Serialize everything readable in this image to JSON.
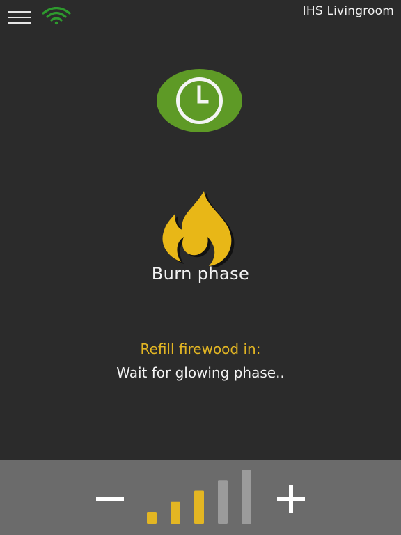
{
  "header": {
    "device_name": "IHS Livingroom",
    "menu_icon": "hamburger-menu-icon",
    "wifi_icon": "wifi-signal-icon",
    "wifi_color": "#2e9a2e"
  },
  "main": {
    "timer_icon": "clock-icon",
    "timer_color": "#5e9a26",
    "phase_icon": "flame-icon",
    "phase_color": "#e8b717",
    "phase_label": "Burn phase",
    "refill_label": "Refill firewood in:",
    "status_text": "Wait for glowing phase.."
  },
  "controls": {
    "decrease_icon": "minus-icon",
    "increase_icon": "plus-icon",
    "level": {
      "current": 3,
      "max": 5
    },
    "active_color": "#e3b623",
    "inactive_color": "#9b9b9b"
  }
}
